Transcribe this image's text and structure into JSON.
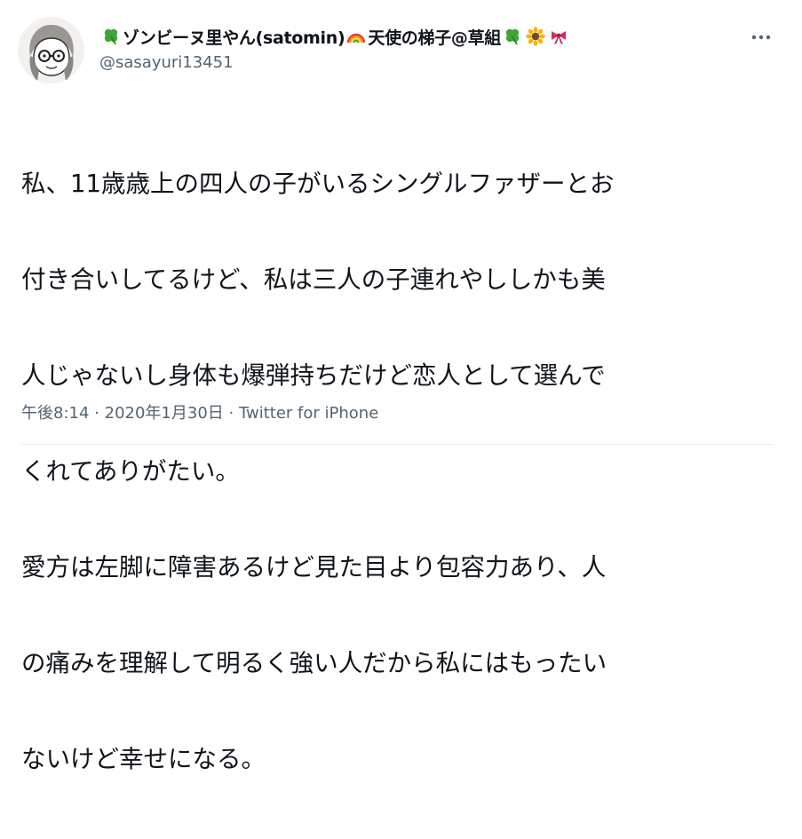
{
  "tweet": {
    "display_name": "ゾンビーヌ里やん(satomin)",
    "display_name_suffix": "天使の梯子@草組",
    "handle": "@sasayuri13451",
    "text_lines": [
      "私、11歳歳上の四人の子がいるシングルファザーとお",
      "付き合いしてるけど、私は三人の子連れやししかも美",
      "人じゃないし身体も爆弾持ちだけど恋人として選んで",
      "くれてありがたい。",
      "愛方は左脚に障害あるけど見た目より包容力あり、人",
      "の痛みを理解して明るく強い人だから私にはもったい",
      "ないけど幸せになる。"
    ],
    "time": "午後8:14",
    "separator": "·",
    "date": "2020年1月30日",
    "source": "Twitter for iPhone"
  },
  "icons": {
    "name_emojis": [
      "clover-icon",
      "rainbow-icon",
      "clover-icon",
      "sunflower-icon",
      "ribbon-icon"
    ],
    "more": "more-horizontal-icon"
  },
  "colors": {
    "text": "#0f1419",
    "secondary": "#536471",
    "clover": "#3fa535",
    "ribbon": "#e0245e",
    "sunflower": "#ffb000"
  }
}
